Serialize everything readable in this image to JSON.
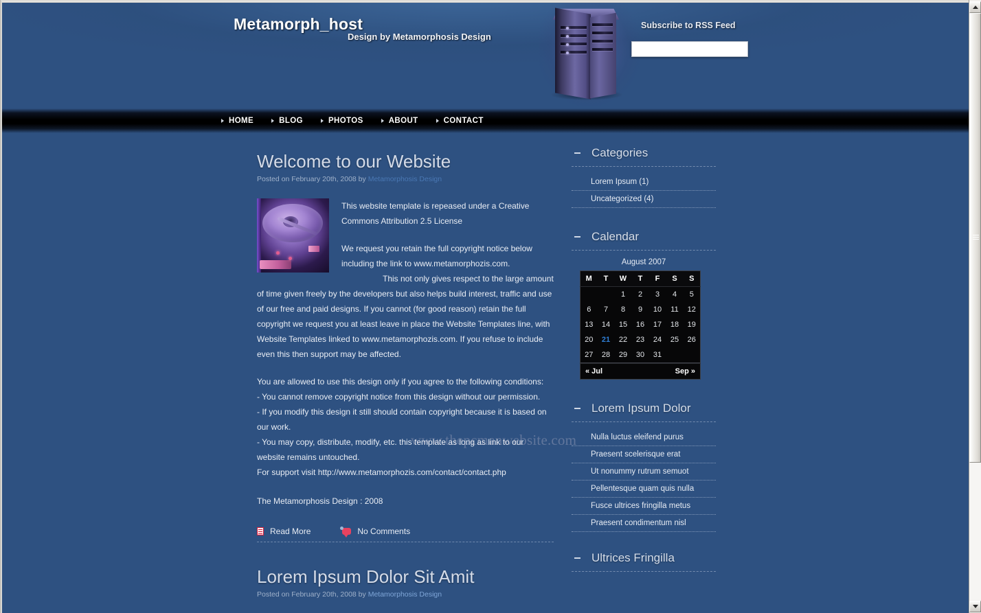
{
  "site": {
    "brand": "Metamorph_host",
    "tagline": "Design by Metamorphosis Design",
    "watermark": "www.thepcmanwebsite.com"
  },
  "rss": {
    "label": "Subscribe to RSS Feed",
    "value": "",
    "placeholder": ""
  },
  "nav": {
    "items": [
      {
        "label": "HOME"
      },
      {
        "label": "BLOG"
      },
      {
        "label": "PHOTOS"
      },
      {
        "label": "ABOUT"
      },
      {
        "label": "CONTACT"
      }
    ]
  },
  "posts": [
    {
      "title": "Welcome to our Website",
      "meta_prefix": "Posted on February 20th, 2008 by",
      "author": "Metamorphosis Design",
      "thumb_alt": "hard-drive-photo",
      "paragraph_1": [
        "This website template is repeased under a Creative",
        "Commons Attribution 2.5 License"
      ],
      "paragraph_2": [
        "We request you retain the full copyright notice below",
        "including the link to www.metamorphozis.com.",
        "This not only gives respect to the large amount of time given freely by the developers but also helps build interest, traffic and use of our free and paid designs. If you cannot (for good reason) retain the full copyright we request you at least leave in place the Website Templates line, with Website Templates linked to www.metamorphozis.com. If you refuse to include even this then support may be affected."
      ],
      "conditions_intro": "You are allowed to use this design only if you agree to the following conditions:",
      "conditions": [
        "- You cannot remove copyright notice from this design without our permission.",
        "- If you modify this design it still should contain copyright because it is based on our work.",
        "- You may copy, distribute, modify, etc. this template as long as link to our website remains untouched.",
        "For support visit http://www.metamorphozis.com/contact/contact.php"
      ],
      "signature": "The Metamorphosis Design : 2008",
      "read_more": "Read More",
      "comments": "No Comments"
    },
    {
      "title": "Lorem Ipsum Dolor Sit Amit",
      "meta_prefix": "Posted on February 20th, 2008 by",
      "author": "Metamorphosis Design"
    }
  ],
  "sidebar": {
    "categories": {
      "title": "Categories",
      "items": [
        {
          "label": "Lorem Ipsum (1)"
        },
        {
          "label": "Uncategorized (4)"
        }
      ]
    },
    "calendar": {
      "title": "Calendar",
      "caption": "August 2007",
      "weekdays": [
        "M",
        "T",
        "W",
        "T",
        "F",
        "S",
        "S"
      ],
      "weeks": [
        [
          "",
          "",
          "1",
          "2",
          "3",
          "4",
          "5"
        ],
        [
          "6",
          "7",
          "8",
          "9",
          "10",
          "11",
          "12"
        ],
        [
          "13",
          "14",
          "15",
          "16",
          "17",
          "18",
          "19"
        ],
        [
          "20",
          "21",
          "22",
          "23",
          "24",
          "25",
          "26"
        ],
        [
          "27",
          "28",
          "29",
          "30",
          "31",
          "",
          ""
        ]
      ],
      "today": "21",
      "prev": "« Jul",
      "next": "Sep »"
    },
    "lorem_dolor": {
      "title": "Lorem Ipsum Dolor",
      "items": [
        {
          "label": "Nulla luctus eleifend purus"
        },
        {
          "label": "Praesent scelerisque erat"
        },
        {
          "label": "Ut nonummy rutrum semuot"
        },
        {
          "label": "Pellentesque quam quis nulla"
        },
        {
          "label": "Fusce ultrices fringilla metus"
        },
        {
          "label": "Praesent condimentum nisl"
        }
      ]
    },
    "ultrices": {
      "title": "Ultrices Fringilla"
    }
  },
  "colors": {
    "page_bg": "#2e5181",
    "header_dark": "#05070c",
    "accent_link": "#4a78b4",
    "today_highlight": "#2f7fd6",
    "icon_red": "#e8425f"
  }
}
